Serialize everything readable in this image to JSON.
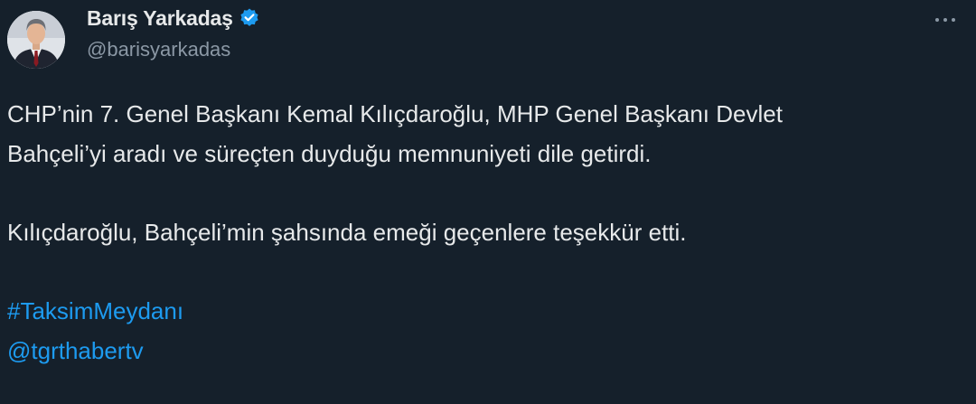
{
  "author": {
    "display_name": "Barış Yarkadaş",
    "handle": "@barisyarkadas",
    "verified_color": "#1d9bf0"
  },
  "icons": {
    "verified": "verified-badge-icon",
    "more": "more-options-icon"
  },
  "tweet": {
    "paragraph_1_line_1": "CHP’nin 7. Genel Başkanı Kemal Kılıçdaroğlu, MHP Genel Başkanı Devlet",
    "paragraph_1_line_2": "Bahçeli’yi aradı ve süreçten duyduğu memnuniyeti dile getirdi.",
    "paragraph_2": "Kılıçdaroğlu, Bahçeli’min şahsında emeği geçenlere teşekkür etti.",
    "hashtag": "#TaksimMeydanı",
    "mention": "@tgrthabertv"
  },
  "colors": {
    "background": "#15202b",
    "text": "#e7e9ea",
    "secondary_text": "#8b98a5",
    "link": "#1d9bf0"
  }
}
